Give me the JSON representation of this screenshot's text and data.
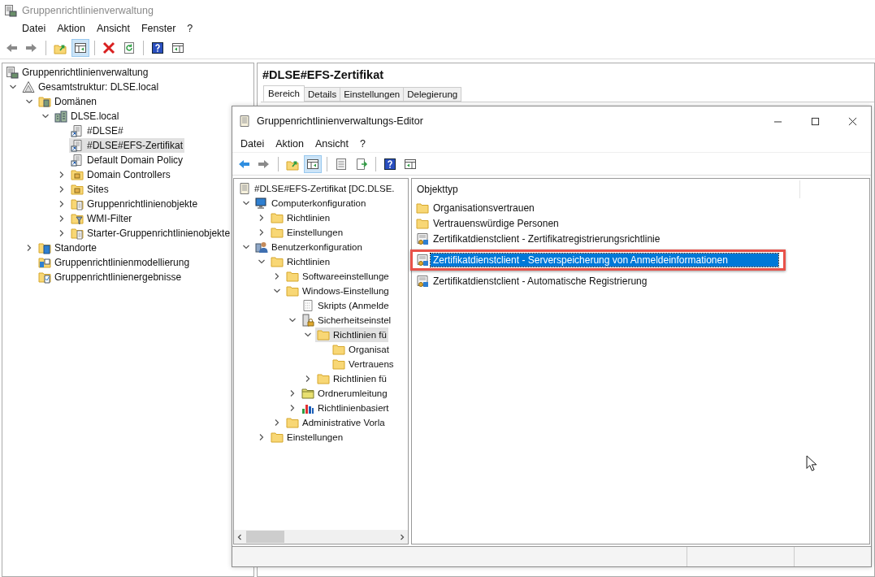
{
  "main_window": {
    "title": "Gruppenrichtlinienverwaltung",
    "menu": [
      "Datei",
      "Aktion",
      "Ansicht",
      "Fenster",
      "?"
    ],
    "toolbar": [
      {
        "kind": "back",
        "pressed": false
      },
      {
        "kind": "forward",
        "pressed": false
      },
      {
        "kind": "sep"
      },
      {
        "kind": "up",
        "pressed": false
      },
      {
        "kind": "tree",
        "pressed": true
      },
      {
        "kind": "sep"
      },
      {
        "kind": "delete",
        "pressed": false
      },
      {
        "kind": "refresh",
        "pressed": false
      },
      {
        "kind": "sep"
      },
      {
        "kind": "help",
        "pressed": false
      },
      {
        "kind": "pane",
        "pressed": false
      }
    ],
    "tree": {
      "items": [
        {
          "label": "Gruppenrichtlinienverwaltung",
          "kind": "gpm",
          "selected": false,
          "children": [
            {
              "label": "Gesamtstruktur: DLSE.local",
              "kind": "forest",
              "selected": false,
              "expanded": true,
              "children": [
                {
                  "label": "Domänen",
                  "kind": "domains",
                  "selected": false,
                  "expanded": true,
                  "children": [
                    {
                      "label": "DLSE.local",
                      "kind": "domain",
                      "selected": false,
                      "expanded": true,
                      "children": [
                        {
                          "label": "#DLSE#",
                          "kind": "gpo-link",
                          "selected": false
                        },
                        {
                          "label": "#DLSE#EFS-Zertifikat",
                          "kind": "gpo-link",
                          "selected": true
                        },
                        {
                          "label": "Default Domain Policy",
                          "kind": "gpo-link",
                          "selected": false
                        },
                        {
                          "label": "Domain Controllers",
                          "kind": "ou",
                          "selected": false,
                          "expanded": false
                        },
                        {
                          "label": "Sites",
                          "kind": "ou",
                          "selected": false,
                          "expanded": false
                        },
                        {
                          "label": "Gruppenrichtlinienobjekte",
                          "kind": "folder-doc",
                          "selected": false,
                          "expanded": false
                        },
                        {
                          "label": "WMI-Filter",
                          "kind": "folder-filter",
                          "selected": false,
                          "expanded": false
                        },
                        {
                          "label": "Starter-Gruppenrichtlinienobjekte",
                          "kind": "folder-doc",
                          "selected": false,
                          "expanded": false
                        }
                      ]
                    }
                  ]
                },
                {
                  "label": "Standorte",
                  "kind": "sites",
                  "selected": false,
                  "expanded": false
                },
                {
                  "label": "Gruppenrichtlinienmodellierung",
                  "kind": "modeling",
                  "selected": false
                },
                {
                  "label": "Gruppenrichtlinienergebnisse",
                  "kind": "results",
                  "selected": false
                }
              ]
            }
          ]
        }
      ]
    },
    "details": {
      "title": "#DLSE#EFS-Zertifikat",
      "tabs": [
        {
          "label": "Bereich",
          "selected": true
        },
        {
          "label": "Details",
          "selected": false
        },
        {
          "label": "Einstellungen",
          "selected": false
        },
        {
          "label": "Delegierung",
          "selected": false
        }
      ]
    }
  },
  "editor_window": {
    "title": "Gruppenrichtlinienverwaltungs-Editor",
    "menu": [
      "Datei",
      "Aktion",
      "Ansicht",
      "?"
    ],
    "toolbar": [
      {
        "kind": "back",
        "pressed": false
      },
      {
        "kind": "forward",
        "pressed": false
      },
      {
        "kind": "sep"
      },
      {
        "kind": "up",
        "pressed": false
      },
      {
        "kind": "tree",
        "pressed": true
      },
      {
        "kind": "sep"
      },
      {
        "kind": "properties",
        "pressed": false
      },
      {
        "kind": "export",
        "pressed": false
      },
      {
        "kind": "sep"
      },
      {
        "kind": "help",
        "pressed": false
      },
      {
        "kind": "pane",
        "pressed": false
      }
    ],
    "tree": {
      "items": [
        {
          "label": "#DLSE#EFS-Zertifikat [DC.DLSE.",
          "kind": "policy",
          "selected": false,
          "children": [
            {
              "label": "Computerkonfiguration",
              "kind": "computer",
              "selected": false,
              "expanded": true,
              "children": [
                {
                  "label": "Richtlinien",
                  "kind": "folder",
                  "selected": false,
                  "expanded": false
                },
                {
                  "label": "Einstellungen",
                  "kind": "folder",
                  "selected": false,
                  "expanded": false
                }
              ]
            },
            {
              "label": "Benutzerkonfiguration",
              "kind": "user",
              "selected": false,
              "expanded": true,
              "children": [
                {
                  "label": "Richtlinien",
                  "kind": "folder",
                  "selected": false,
                  "expanded": true,
                  "children": [
                    {
                      "label": "Softwareeinstellunge",
                      "kind": "folder",
                      "selected": false,
                      "expanded": false
                    },
                    {
                      "label": "Windows-Einstellung",
                      "kind": "folder",
                      "selected": false,
                      "expanded": true,
                      "children": [
                        {
                          "label": "Skripts (Anmelde",
                          "kind": "script",
                          "selected": false
                        },
                        {
                          "label": "Sicherheitseinstel",
                          "kind": "security",
                          "selected": false,
                          "expanded": true,
                          "children": [
                            {
                              "label": "Richtlinien fü",
                              "kind": "folder",
                              "selected": true,
                              "expanded": true,
                              "children": [
                                {
                                  "label": "Organisat",
                                  "kind": "folder",
                                  "selected": false
                                },
                                {
                                  "label": "Vertrauens",
                                  "kind": "folder",
                                  "selected": false
                                }
                              ]
                            },
                            {
                              "label": "Richtlinien fü",
                              "kind": "folder",
                              "selected": false,
                              "expanded": false
                            }
                          ]
                        },
                        {
                          "label": "Ordnerumleitung",
                          "kind": "redirect",
                          "selected": false,
                          "expanded": false
                        },
                        {
                          "label": "Richtlinienbasiert",
                          "kind": "chart",
                          "selected": false,
                          "expanded": false
                        }
                      ]
                    },
                    {
                      "label": "Administrative Vorla",
                      "kind": "folder",
                      "selected": false,
                      "expanded": false
                    }
                  ]
                },
                {
                  "label": "Einstellungen",
                  "kind": "folder",
                  "selected": false,
                  "expanded": false
                }
              ]
            }
          ]
        }
      ]
    },
    "list": {
      "columns": [
        "Objekttyp"
      ],
      "rows": [
        {
          "label": "Organisationsvertrauen",
          "kind": "folder",
          "selected": false,
          "highlighted": false
        },
        {
          "label": "Vertrauenswürdige Personen",
          "kind": "folder",
          "selected": false,
          "highlighted": false
        },
        {
          "label": "Zertifikatdienstclient - Zertifikatregistrierungsrichtlinie",
          "kind": "cert",
          "selected": false,
          "highlighted": false
        },
        {
          "label": "Zertifikatdienstclient - Serverspeicherung von Anmeldeinformationen",
          "kind": "cert",
          "selected": true,
          "highlighted": true
        },
        {
          "label": "Zertifikatdienstclient - Automatische Registrierung",
          "kind": "cert",
          "selected": false,
          "highlighted": false
        }
      ]
    }
  }
}
